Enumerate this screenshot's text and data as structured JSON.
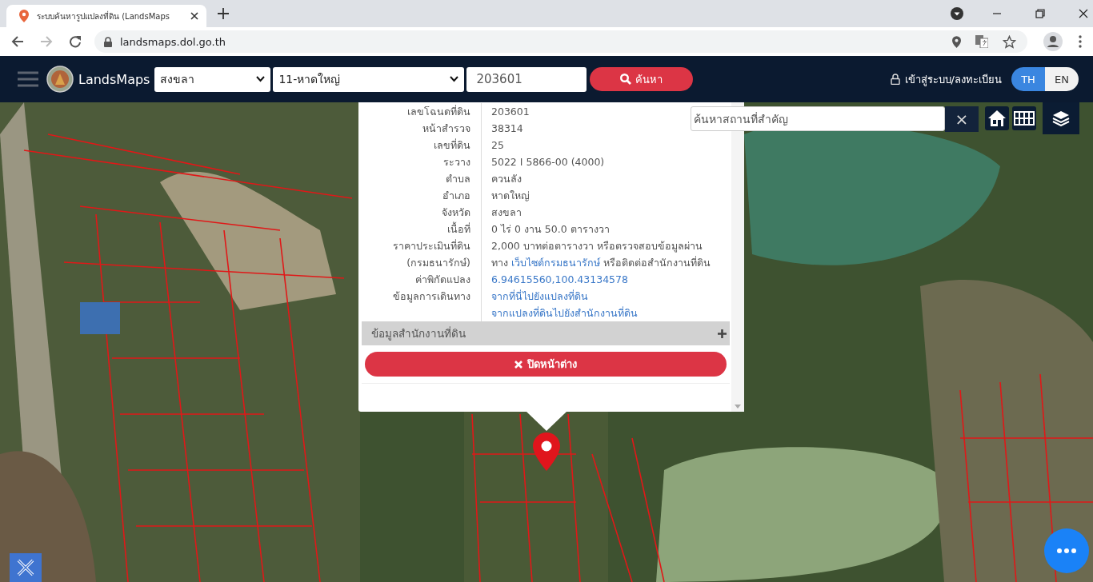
{
  "browser": {
    "tab_title": "ระบบค้นหารูปแปลงที่ดิน (LandsMaps",
    "url": "landsmaps.dol.go.th"
  },
  "header": {
    "brand": "LandsMaps",
    "province": "สงขลา",
    "district": "11-หาดใหญ่",
    "parcel_number": "203601",
    "search_label": "ค้นหา",
    "login_label": "เข้าสู่ระบบ/ลงทะเบียน",
    "languages": [
      {
        "label": "TH",
        "selected": true
      },
      {
        "label": "EN",
        "selected": false
      }
    ]
  },
  "popup": {
    "rows": [
      {
        "kind": "text",
        "label_lines": [
          "เลขโฉนดที่ดิน"
        ],
        "value": "203601"
      },
      {
        "kind": "text",
        "label_lines": [
          "หน้าสำรวจ"
        ],
        "value": "38314"
      },
      {
        "kind": "text",
        "label_lines": [
          "เลขที่ดิน"
        ],
        "value": "25"
      },
      {
        "kind": "text",
        "label_lines": [
          "ระวาง"
        ],
        "value": "5022 I 5866-00 (4000)"
      },
      {
        "kind": "text",
        "label_lines": [
          "ตำบล"
        ],
        "value": "ควนลัง"
      },
      {
        "kind": "text",
        "label_lines": [
          "อำเภอ"
        ],
        "value": "หาดใหญ่"
      },
      {
        "kind": "text",
        "label_lines": [
          "จังหวัด"
        ],
        "value": "สงขลา"
      },
      {
        "kind": "text",
        "label_lines": [
          "เนื้อที่"
        ],
        "value": "0 ไร่ 0 งาน 50.0 ตารางวา"
      },
      {
        "kind": "price",
        "label_lines": [
          "ราคาประเมินที่ดิน",
          "(กรมธนารักษ์)"
        ],
        "line_1": "2,000 บาทต่อตารางวา หรือตรวจสอบข้อมูลผ่าน",
        "line_2_before": "ทาง",
        "link": "เว็บไซต์กรมธนารักษ์",
        "line_2_after": "หรือติดต่อสำนักงานที่ดิน"
      },
      {
        "kind": "links",
        "label_lines": [
          "ค่าพิกัดแปลง"
        ],
        "links": [
          "6.94615560,100.43134578"
        ]
      },
      {
        "kind": "links",
        "label_lines": [
          "ข้อมูลการเดินทาง"
        ],
        "links": [
          "จากที่นี่ไปยังแปลงที่ดิน",
          "จากแปลงที่ดินไปยังสำนักงานที่ดิน"
        ]
      }
    ],
    "section": {
      "label": "ข้อมูลสำนักงานที่ดิน",
      "expanded": false
    },
    "close_label": "ปิดหน้าต่าง"
  },
  "map": {
    "search": {
      "placeholder": "ค้นหาสถานที่สำคัญ"
    },
    "clear_symbol": "×"
  }
}
